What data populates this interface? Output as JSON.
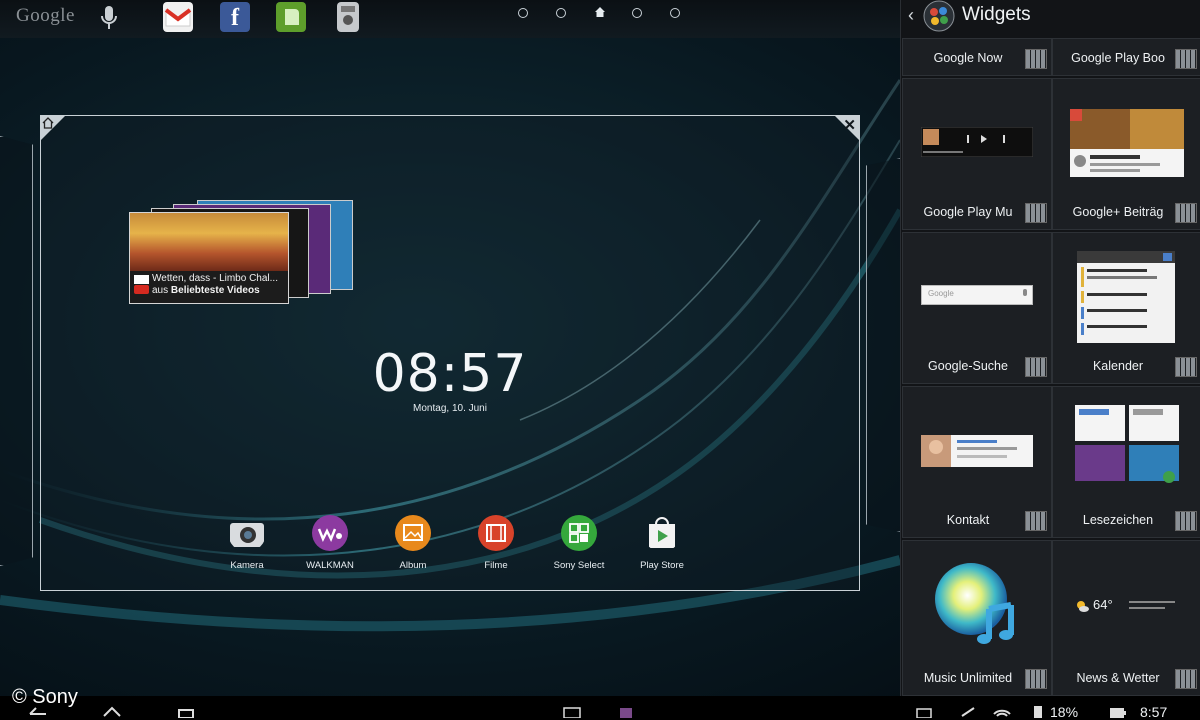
{
  "topbar": {
    "google_logo": "Google",
    "icons": [
      "microphone-icon",
      "gmail-icon",
      "facebook-icon",
      "evernote-icon",
      "settings-app-icon"
    ],
    "facebook_glyph": "f",
    "page_dots": 5,
    "current_page": "home"
  },
  "home_preview": {
    "youtube_widget": {
      "title": "Wetten, dass - Limbo Chal...",
      "prefix": "aus",
      "channel": "Beliebteste Videos"
    },
    "clock": "08:57",
    "date": "Montag, 10. Juni",
    "dock": [
      {
        "label": "Kamera",
        "icon": "camera-icon",
        "color": "#d9dcdf"
      },
      {
        "label": "WALKMAN",
        "icon": "walkman-icon",
        "color": "#8c3aa0"
      },
      {
        "label": "Album",
        "icon": "album-icon",
        "color": "#e8891c"
      },
      {
        "label": "Filme",
        "icon": "movies-icon",
        "color": "#d8432a"
      },
      {
        "label": "Sony Select",
        "icon": "sony-select-icon",
        "color": "#35a83c"
      },
      {
        "label": "Play Store",
        "icon": "play-store-icon",
        "color": "#f2f2f2"
      }
    ]
  },
  "widgets_panel": {
    "title": "Widgets",
    "items": [
      {
        "label": "Google Now"
      },
      {
        "label": "Google Play Boo"
      },
      {
        "label": "Google Play Mu"
      },
      {
        "label": "Google+ Beiträg"
      },
      {
        "label": "Google-Suche"
      },
      {
        "label": "Kalender"
      },
      {
        "label": "Kontakt"
      },
      {
        "label": "Lesezeichen"
      },
      {
        "label": "Music Unlimited"
      },
      {
        "label": "News & Wetter"
      }
    ],
    "weather_temp": "64°",
    "google_search_placeholder": "Google"
  },
  "status_bar": {
    "copyright": "© Sony",
    "battery": "18%",
    "time": "8:57"
  },
  "colors": {
    "accent_teal": "#3fb9c8",
    "panel_bg": "#121417"
  }
}
